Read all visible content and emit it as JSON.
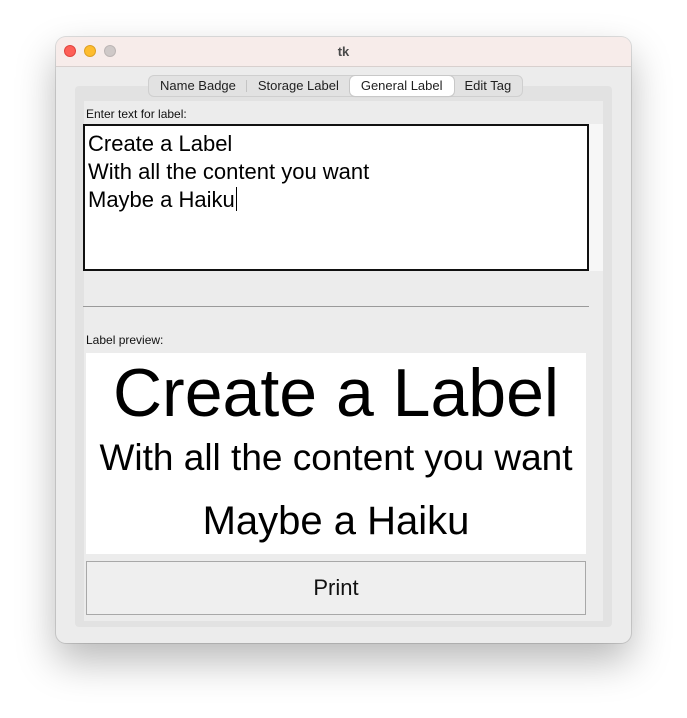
{
  "window": {
    "title": "tk"
  },
  "tabs": [
    {
      "label": "Name Badge",
      "active": false
    },
    {
      "label": "Storage Label",
      "active": false
    },
    {
      "label": "General Label",
      "active": true
    },
    {
      "label": "Edit Tag",
      "active": false
    }
  ],
  "editor": {
    "prompt": "Enter text for label:",
    "lines": [
      "Create a Label",
      "With all the content you want",
      "Maybe a Haiku"
    ]
  },
  "preview": {
    "heading": "Label preview:",
    "lines": [
      "Create a Label",
      "With all the content you want",
      "Maybe a Haiku"
    ]
  },
  "actions": {
    "print_label": "Print"
  },
  "colors": {
    "close": "#fe5f57",
    "minimize": "#febc2e",
    "zoom_inactive": "#cfc9c8"
  }
}
